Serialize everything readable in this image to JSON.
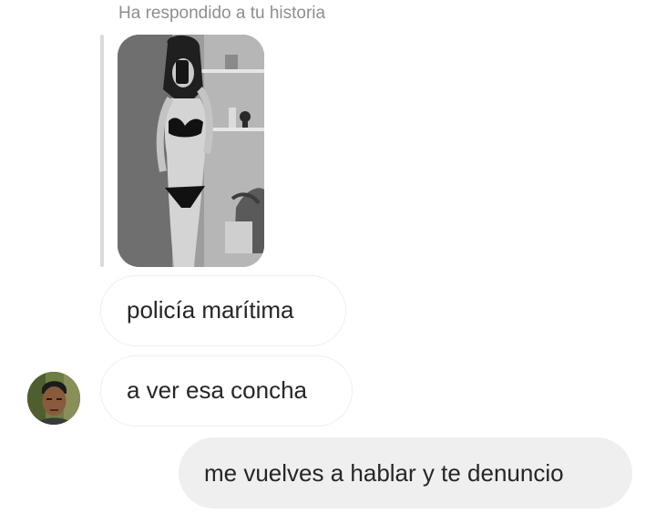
{
  "story_reply": {
    "header": "Ha respondido a tu historia"
  },
  "messages": [
    {
      "sender": "them",
      "text": "policía marítima"
    },
    {
      "sender": "them",
      "text": "a ver esa concha"
    },
    {
      "sender": "me",
      "text": "me vuelves a hablar y te denuncio"
    }
  ],
  "colors": {
    "incoming_bubble_border": "#efefef",
    "outgoing_bubble_bg": "#efefef",
    "meta_text": "#8e8e8e",
    "message_text": "#262626"
  },
  "icons": {
    "story_preview": "story-thumbnail-image",
    "sender_avatar": "profile-avatar"
  }
}
